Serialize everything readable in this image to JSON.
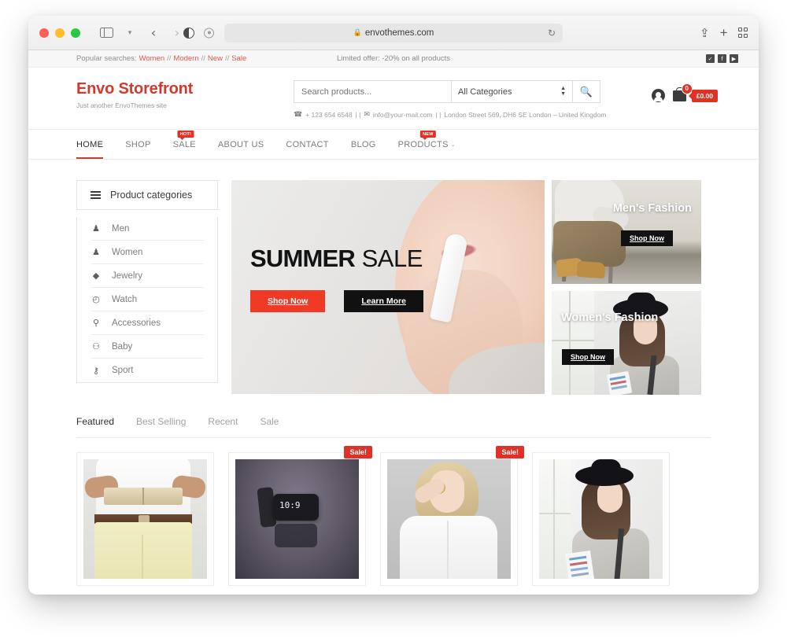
{
  "browser": {
    "url": "envothemes.com",
    "lock_icon": "lock-icon",
    "reload_icon": "reload-icon",
    "back_icon": "back-arrow-icon",
    "forward_icon": "forward-arrow-icon",
    "sidebar_icon": "sidebar-toggle-icon",
    "share_icon": "share-icon",
    "newtab_icon": "new-tab-icon",
    "tabs_overview_icon": "tab-overview-icon",
    "shield_icon": "reader-contrast-icon",
    "page_settings_icon": "page-settings-icon"
  },
  "topbar": {
    "popular_label": "Popular searches:",
    "popular_links": [
      "Women",
      "Modern",
      "New",
      "Sale"
    ],
    "separator": "//",
    "offer": "Limited offer: -20% on all products",
    "socials": [
      {
        "name": "twitter-icon",
        "glyph": "✓"
      },
      {
        "name": "facebook-icon",
        "glyph": "f"
      },
      {
        "name": "youtube-icon",
        "glyph": "▶"
      }
    ]
  },
  "header": {
    "logo": "Envo Storefront",
    "tagline": "Just another EnvoThemes site",
    "search_placeholder": "Search products...",
    "search_value": "",
    "category_selected": "All Categories",
    "search_icon": "search-icon",
    "phone": "+ 123 654 6548",
    "email": "info@your-mail.com",
    "address": "London Street 569, DH6 SE London – United Kingdom",
    "contact_sep": "| |",
    "phone_icon": "phone-icon",
    "mail_icon": "envelope-icon",
    "account_icon": "user-account-icon",
    "cart_icon": "shopping-bag-icon",
    "cart_count": "0",
    "cart_total": "£0.00"
  },
  "nav": {
    "items": [
      {
        "label": "HOME",
        "active": true,
        "badge": ""
      },
      {
        "label": "SHOP",
        "active": false,
        "badge": ""
      },
      {
        "label": "SALE",
        "active": false,
        "badge": "HOT!"
      },
      {
        "label": "ABOUT US",
        "active": false,
        "badge": ""
      },
      {
        "label": "CONTACT",
        "active": false,
        "badge": ""
      },
      {
        "label": "BLOG",
        "active": false,
        "badge": ""
      },
      {
        "label": "PRODUCTS",
        "active": false,
        "badge": "NEW",
        "caret": "⌄"
      }
    ]
  },
  "sidebar": {
    "title": "Product categories",
    "menu_icon": "hamburger-icon",
    "items": [
      {
        "label": "Men",
        "icon": "men-icon",
        "glyph": "♟"
      },
      {
        "label": "Women",
        "icon": "women-icon",
        "glyph": "♟"
      },
      {
        "label": "Jewelry",
        "icon": "diamond-icon",
        "glyph": "◆"
      },
      {
        "label": "Watch",
        "icon": "clock-icon",
        "glyph": "◴"
      },
      {
        "label": "Accessories",
        "icon": "bulb-icon",
        "glyph": "⚲"
      },
      {
        "label": "Baby",
        "icon": "baby-icon",
        "glyph": "⚇"
      },
      {
        "label": "Sport",
        "icon": "bicycle-icon",
        "glyph": "⚷"
      }
    ]
  },
  "hero": {
    "title_bold": "SUMMER",
    "title_light": "SALE",
    "primary_btn": "Shop Now",
    "secondary_btn": "Learn More"
  },
  "side_banners": [
    {
      "title": "Men's Fashion",
      "btn": "Shop Now"
    },
    {
      "title": "Women's Fashion",
      "btn": "Shop Now"
    }
  ],
  "tabs": [
    {
      "label": "Featured",
      "active": true
    },
    {
      "label": "Best Selling",
      "active": false
    },
    {
      "label": "Recent",
      "active": false
    },
    {
      "label": "Sale",
      "active": false
    }
  ],
  "products": [
    {
      "name": "product-1",
      "badge": ""
    },
    {
      "name": "product-2",
      "badge": "Sale!"
    },
    {
      "name": "product-3",
      "badge": "Sale!"
    },
    {
      "name": "product-4",
      "badge": ""
    }
  ]
}
